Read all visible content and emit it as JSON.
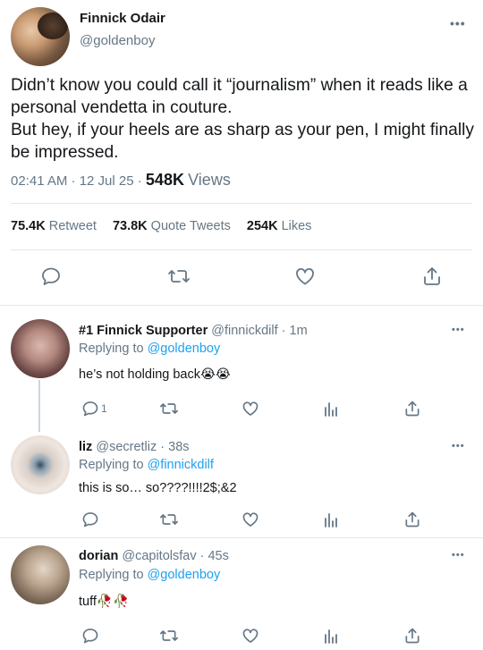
{
  "main": {
    "name": "Finnick Odair",
    "handle": "@goldenboy",
    "text": "Didn’t know you could call it “journalism” when it reads like a personal vendetta in couture.\nBut hey, if your heels are as sharp as your pen, I might finally be impressed.",
    "time": "02:41 AM · 12 Jul 25 ·",
    "views_count": "548K",
    "views_label": "Views",
    "retweets": "75.4K",
    "retweet_label": "Retweet",
    "quotes": "73.8K",
    "quote_label": "Quote Tweets",
    "likes": "254K",
    "likes_label": "Likes"
  },
  "replies": [
    {
      "name": "#1 Finnick Supporter",
      "handle": "@finnickdilf · 1m",
      "replying_prefix": "Replying to",
      "replying_to": "@goldenboy",
      "text": "he’s not holding back😭😭",
      "reply_count": "1"
    },
    {
      "name": "liz",
      "handle": "@secretliz · 38s",
      "replying_prefix": "Replying to",
      "replying_to": "@finnickdilf",
      "text": "this is so… so????!!!!2$;&2"
    },
    {
      "name": "dorian",
      "handle": "@capitolsfav · 45s",
      "replying_prefix": "Replying to",
      "replying_to": "@goldenboy",
      "text": "tuff🥀🥀"
    }
  ],
  "icons": {
    "reply": "reply-icon",
    "retweet": "retweet-icon",
    "like": "heart-icon",
    "share": "share-icon",
    "analytics": "analytics-icon",
    "more": "more-icon"
  },
  "colors": {
    "link": "#1da1f2",
    "secondary": "#657786",
    "divider": "#e1e8ed"
  }
}
